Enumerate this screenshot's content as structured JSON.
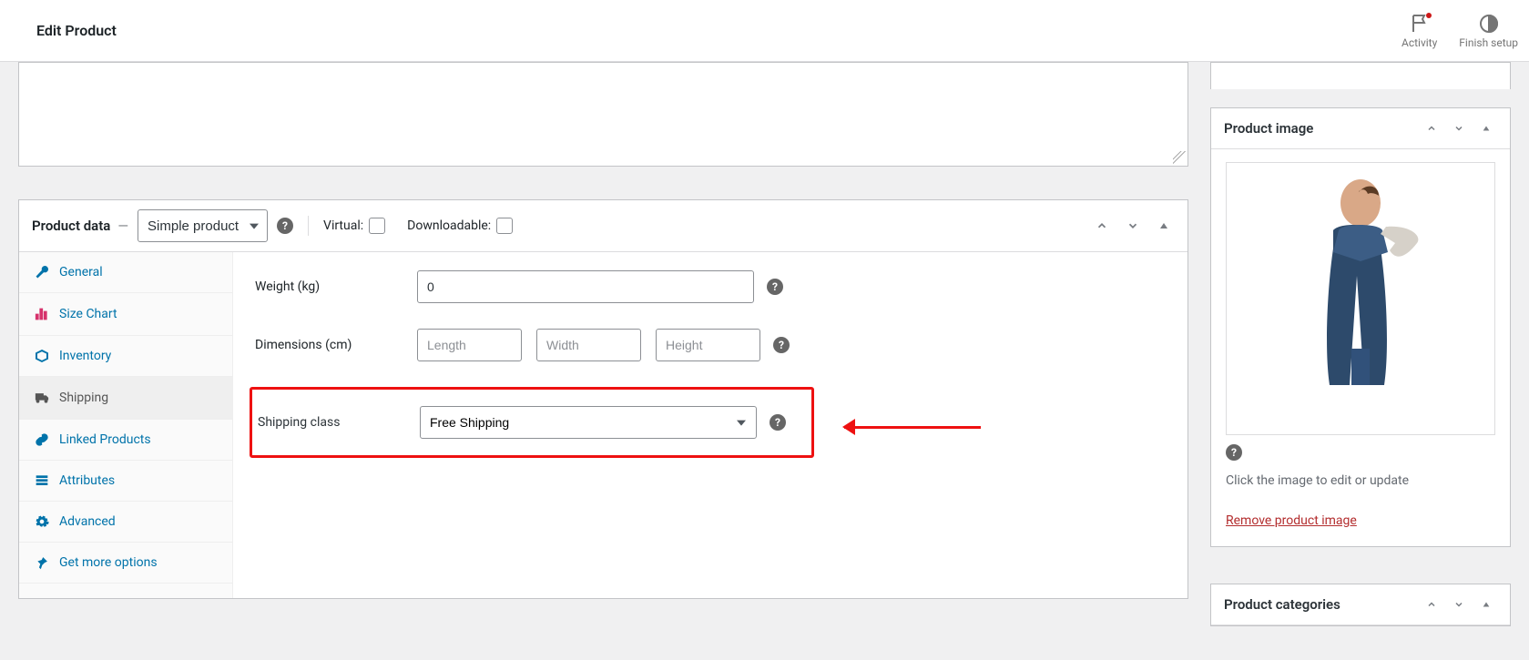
{
  "header": {
    "title": "Edit Product",
    "activity_label": "Activity",
    "finish_setup_label": "Finish setup"
  },
  "product_data": {
    "panel_title": "Product data",
    "type_selected": "Simple product",
    "virtual_label": "Virtual:",
    "downloadable_label": "Downloadable:"
  },
  "tabs": {
    "general": "General",
    "size_chart": "Size Chart",
    "inventory": "Inventory",
    "shipping": "Shipping",
    "linked": "Linked Products",
    "attributes": "Attributes",
    "advanced": "Advanced",
    "more": "Get more options"
  },
  "shipping": {
    "weight_label": "Weight (kg)",
    "weight_value": "0",
    "dimensions_label": "Dimensions (cm)",
    "length_ph": "Length",
    "width_ph": "Width",
    "height_ph": "Height",
    "class_label": "Shipping class",
    "class_value": "Free Shipping"
  },
  "sidebar": {
    "product_image_title": "Product image",
    "click_hint": "Click the image to edit or update",
    "remove_link": "Remove product image",
    "product_categories_title": "Product categories"
  }
}
